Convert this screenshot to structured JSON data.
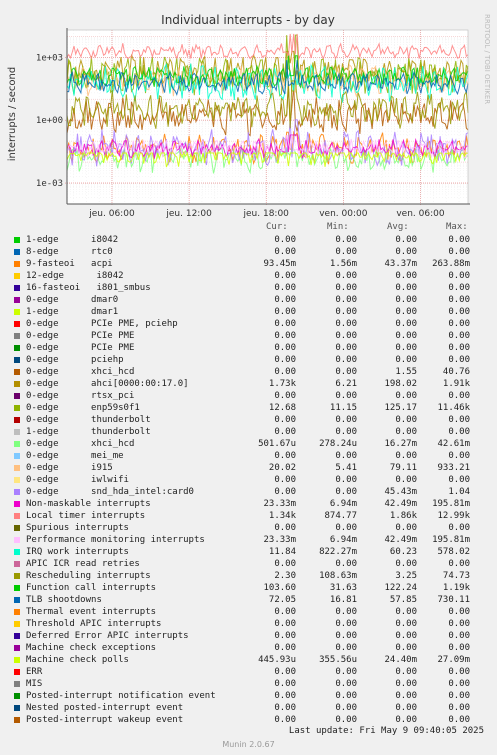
{
  "chart_data": {
    "type": "line",
    "title": "Individual interrupts - by day",
    "ylabel": "interrupts / second",
    "side_label": "RRDTOOL / TOBI OETIKER",
    "y_scale": "log",
    "ylim": [
      0.0001,
      20000
    ],
    "y_ticks": [
      {
        "label": "1e+03",
        "value": 1000
      },
      {
        "label": "1e+00",
        "value": 1
      },
      {
        "label": "1e-03",
        "value": 0.001
      }
    ],
    "x_ticks": [
      {
        "label": "jeu. 06:00",
        "hours": 6
      },
      {
        "label": "jeu. 12:00",
        "hours": 12
      },
      {
        "label": "jeu. 18:00",
        "hours": 18
      },
      {
        "label": "ven. 00:00",
        "hours": 24
      },
      {
        "label": "ven. 06:00",
        "hours": 30
      }
    ],
    "x_range_hours": [
      2.5,
      33.7
    ],
    "grid": true,
    "legend_headers": [
      "Cur:",
      "Min:",
      "Avg:",
      "Max:"
    ],
    "series": [
      {
        "name": "1-edge      i8042",
        "color": "#00cc00",
        "cur": "0.00",
        "min": "0.00",
        "avg": "0.00",
        "max": "0.00"
      },
      {
        "name": "8-edge      rtc0",
        "color": "#0066b3",
        "cur": "0.00",
        "min": "0.00",
        "avg": "0.00",
        "max": "0.00"
      },
      {
        "name": "9-fasteoi   acpi",
        "color": "#ff8000",
        "cur": "93.45m",
        "min": "1.56m",
        "avg": "43.37m",
        "max": "263.88m"
      },
      {
        "name": "12-edge      i8042",
        "color": "#ffcc00",
        "cur": "0.00",
        "min": "0.00",
        "avg": "0.00",
        "max": "0.00"
      },
      {
        "name": "16-fasteoi   i801_smbus",
        "color": "#330099",
        "cur": "0.00",
        "min": "0.00",
        "avg": "0.00",
        "max": "0.00"
      },
      {
        "name": "0-edge      dmar0",
        "color": "#990099",
        "cur": "0.00",
        "min": "0.00",
        "avg": "0.00",
        "max": "0.00"
      },
      {
        "name": "1-edge      dmar1",
        "color": "#ccff00",
        "cur": "0.00",
        "min": "0.00",
        "avg": "0.00",
        "max": "0.00"
      },
      {
        "name": "0-edge      PCIe PME, pciehp",
        "color": "#ff0000",
        "cur": "0.00",
        "min": "0.00",
        "avg": "0.00",
        "max": "0.00"
      },
      {
        "name": "0-edge      PCIe PME",
        "color": "#808080",
        "cur": "0.00",
        "min": "0.00",
        "avg": "0.00",
        "max": "0.00"
      },
      {
        "name": "0-edge      PCIe PME",
        "color": "#008f00",
        "cur": "0.00",
        "min": "0.00",
        "avg": "0.00",
        "max": "0.00"
      },
      {
        "name": "0-edge      pciehp",
        "color": "#00487d",
        "cur": "0.00",
        "min": "0.00",
        "avg": "0.00",
        "max": "0.00"
      },
      {
        "name": "0-edge      xhci_hcd",
        "color": "#b35a00",
        "cur": "0.00",
        "min": "0.00",
        "avg": "1.55",
        "max": "40.76"
      },
      {
        "name": "0-edge      ahci[0000:00:17.0]",
        "color": "#b38f00",
        "cur": "1.73k",
        "min": "6.21",
        "avg": "198.02",
        "max": "1.91k"
      },
      {
        "name": "0-edge      rtsx_pci",
        "color": "#6b006b",
        "cur": "0.00",
        "min": "0.00",
        "avg": "0.00",
        "max": "0.00"
      },
      {
        "name": "0-edge      enp59s0f1",
        "color": "#8fb300",
        "cur": "12.68",
        "min": "11.15",
        "avg": "125.17",
        "max": "11.46k"
      },
      {
        "name": "0-edge      thunderbolt",
        "color": "#b30000",
        "cur": "0.00",
        "min": "0.00",
        "avg": "0.00",
        "max": "0.00"
      },
      {
        "name": "1-edge      thunderbolt",
        "color": "#bebebe",
        "cur": "0.00",
        "min": "0.00",
        "avg": "0.00",
        "max": "0.00"
      },
      {
        "name": "0-edge      xhci_hcd",
        "color": "#80ff80",
        "cur": "501.67u",
        "min": "278.24u",
        "avg": "16.27m",
        "max": "42.61m"
      },
      {
        "name": "0-edge      mei_me",
        "color": "#80c9ff",
        "cur": "0.00",
        "min": "0.00",
        "avg": "0.00",
        "max": "0.00"
      },
      {
        "name": "0-edge      i915",
        "color": "#ffc080",
        "cur": "20.02",
        "min": "5.41",
        "avg": "79.11",
        "max": "933.21"
      },
      {
        "name": "0-edge      iwlwifi",
        "color": "#ffe680",
        "cur": "0.00",
        "min": "0.00",
        "avg": "0.00",
        "max": "0.00"
      },
      {
        "name": "0-edge      snd_hda_intel:card0",
        "color": "#aa80ff",
        "cur": "0.00",
        "min": "0.00",
        "avg": "45.43m",
        "max": "1.04"
      },
      {
        "name": "Non-maskable interrupts",
        "color": "#ee00cc",
        "cur": "23.33m",
        "min": "6.94m",
        "avg": "42.49m",
        "max": "195.81m"
      },
      {
        "name": "Local timer interrupts",
        "color": "#ff8080",
        "cur": "1.34k",
        "min": "874.77",
        "avg": "1.86k",
        "max": "12.99k"
      },
      {
        "name": "Spurious interrupts",
        "color": "#666600",
        "cur": "0.00",
        "min": "0.00",
        "avg": "0.00",
        "max": "0.00"
      },
      {
        "name": "Performance monitoring interrupts",
        "color": "#ffbfff",
        "cur": "23.33m",
        "min": "6.94m",
        "avg": "42.49m",
        "max": "195.81m"
      },
      {
        "name": "IRQ work interrupts",
        "color": "#00ffcc",
        "cur": "11.84",
        "min": "822.27m",
        "avg": "60.23",
        "max": "578.02"
      },
      {
        "name": "APIC ICR read retries",
        "color": "#cc6699",
        "cur": "0.00",
        "min": "0.00",
        "avg": "0.00",
        "max": "0.00"
      },
      {
        "name": "Rescheduling interrupts",
        "color": "#999900",
        "cur": "2.30",
        "min": "108.63m",
        "avg": "3.25",
        "max": "74.73"
      },
      {
        "name": "Function call interrupts",
        "color": "#00cc00",
        "cur": "103.60",
        "min": "31.63",
        "avg": "122.24",
        "max": "1.19k"
      },
      {
        "name": "TLB shootdowns",
        "color": "#0066b3",
        "cur": "72.05",
        "min": "16.81",
        "avg": "57.85",
        "max": "730.11"
      },
      {
        "name": "Thermal event interrupts",
        "color": "#ff8000",
        "cur": "0.00",
        "min": "0.00",
        "avg": "0.00",
        "max": "0.00"
      },
      {
        "name": "Threshold APIC interrupts",
        "color": "#ffcc00",
        "cur": "0.00",
        "min": "0.00",
        "avg": "0.00",
        "max": "0.00"
      },
      {
        "name": "Deferred Error APIC interrupts",
        "color": "#330099",
        "cur": "0.00",
        "min": "0.00",
        "avg": "0.00",
        "max": "0.00"
      },
      {
        "name": "Machine check exceptions",
        "color": "#990099",
        "cur": "0.00",
        "min": "0.00",
        "avg": "0.00",
        "max": "0.00"
      },
      {
        "name": "Machine check polls",
        "color": "#ccff00",
        "cur": "445.93u",
        "min": "355.56u",
        "avg": "24.40m",
        "max": "27.09m"
      },
      {
        "name": "ERR",
        "color": "#ff0000",
        "cur": "0.00",
        "min": "0.00",
        "avg": "0.00",
        "max": "0.00"
      },
      {
        "name": "MIS",
        "color": "#808080",
        "cur": "0.00",
        "min": "0.00",
        "avg": "0.00",
        "max": "0.00"
      },
      {
        "name": "Posted-interrupt notification event",
        "color": "#008f00",
        "cur": "0.00",
        "min": "0.00",
        "avg": "0.00",
        "max": "0.00"
      },
      {
        "name": "Nested posted-interrupt event",
        "color": "#00487d",
        "cur": "0.00",
        "min": "0.00",
        "avg": "0.00",
        "max": "0.00"
      },
      {
        "name": "Posted-interrupt wakeup event",
        "color": "#b35a00",
        "cur": "0.00",
        "min": "0.00",
        "avg": "0.00",
        "max": "0.00"
      }
    ]
  },
  "footer": {
    "last_update": "Last update: Fri May  9 09:40:05 2025",
    "generator": "Munin 2.0.67"
  }
}
